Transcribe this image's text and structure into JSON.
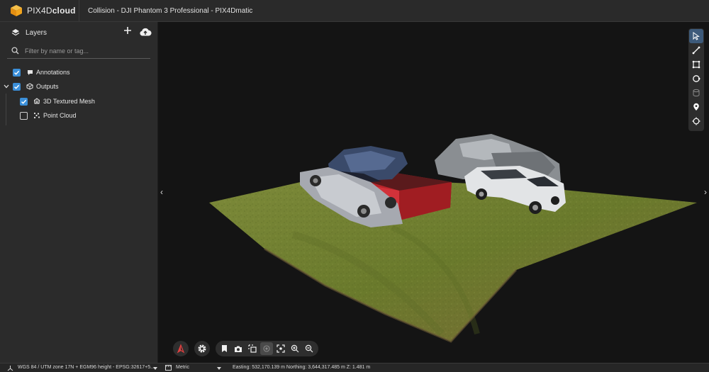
{
  "app": {
    "brand_prefix": "PIX4D",
    "brand_suffix": "cloud",
    "project_title": "Collision - DJI Phantom 3 Professional - PIX4Dmatic",
    "brand_color": "#f3a51d"
  },
  "sidebar": {
    "layers_label": "Layers",
    "search_placeholder": "Filter by name or tag...",
    "tree": [
      {
        "label": "Annotations",
        "checked": true,
        "icon": "comment-icon"
      },
      {
        "label": "Outputs",
        "checked": true,
        "icon": "cube-icon",
        "expanded": true
      },
      {
        "label": "3D Textured Mesh",
        "checked": true,
        "icon": "mesh-icon"
      },
      {
        "label": "Point Cloud",
        "checked": false,
        "icon": "point-cloud-icon"
      }
    ]
  },
  "toolbar": {
    "tools": [
      "select-icon",
      "distance-icon",
      "area-icon",
      "circle-icon",
      "volume-icon",
      "location-pin-icon",
      "crosshair-icon"
    ]
  },
  "view_tools": [
    "bookmark-icon",
    "camera-icon",
    "crop-icon",
    "target-icon",
    "fit-icon",
    "zoom-in-icon",
    "zoom-out-icon"
  ],
  "status": {
    "crs": "WGS 84 / UTM zone 17N + EGM96 height - EPSG:32617+5...",
    "units": "Metric",
    "coords": "Easting: 532,170.139 m   Northing: 3,644,317.485 m   Z: 1.481 m"
  },
  "colors": {
    "accent": "#3b8fd9",
    "header_bg": "#2a2a2a",
    "sidebar_bg": "#2b2b2b",
    "viewport_bg": "#141414"
  }
}
